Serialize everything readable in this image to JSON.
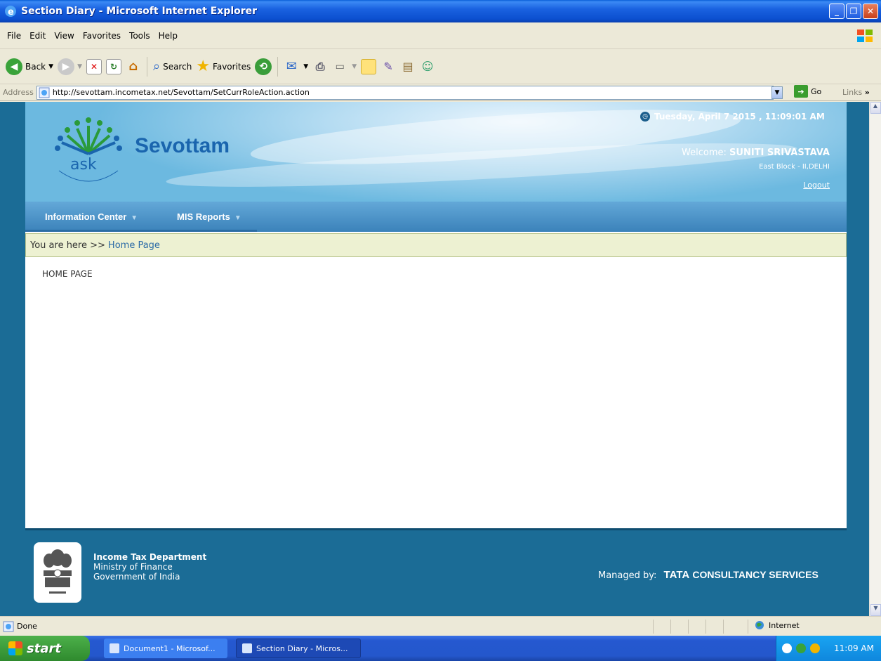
{
  "window": {
    "title": "Section Diary - Microsoft Internet Explorer",
    "controls": [
      "minimize",
      "maximize",
      "close"
    ]
  },
  "menu": {
    "items": [
      "File",
      "Edit",
      "View",
      "Favorites",
      "Tools",
      "Help"
    ]
  },
  "toolbar": {
    "back_label": "Back",
    "search_label": "Search",
    "favorites_label": "Favorites"
  },
  "address": {
    "label": "Address",
    "url": "http://sevottam.incometax.net/Sevottam/SetCurrRoleAction.action",
    "go_label": "Go",
    "links_label": "Links"
  },
  "header": {
    "logo_text": "ask",
    "brand": "Sevottam",
    "datetime": "Tuesday, April 7 2015 , 11:09:01 AM",
    "welcome_prefix": "Welcome:",
    "user_name": "SUNITI SRIVASTAVA",
    "location": "East Block - II,DELHI",
    "logout_label": "Logout"
  },
  "nav": {
    "items": [
      {
        "label": "Information Center"
      },
      {
        "label": "MIS Reports"
      }
    ]
  },
  "breadcrumb": {
    "prefix": "You are here >>",
    "current": "Home Page"
  },
  "main": {
    "page_title": "HOME PAGE"
  },
  "footer": {
    "dept": "Income Tax Department",
    "ministry": "Ministry of Finance",
    "govt": "Government of India",
    "managed_prefix": "Managed by:",
    "managed_brand": "TATA",
    "managed_company": "CONSULTANCY SERVICES"
  },
  "statusbar": {
    "status": "Done",
    "zone": "Internet"
  },
  "taskbar": {
    "start_label": "start",
    "items": [
      {
        "label": "Document1 - Microsof..."
      },
      {
        "label": "Section Diary - Micros..."
      }
    ],
    "clock": "11:09 AM"
  },
  "colors": {
    "page_border": "#1b6c96",
    "nav_blue": "#3b82ba",
    "brand_blue": "#1a65ae",
    "breadcrumb_bg": "#edf1d2"
  }
}
